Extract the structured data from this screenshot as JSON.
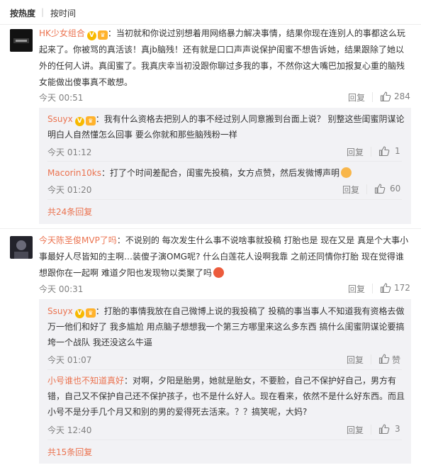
{
  "sort": {
    "by_hot": "按热度",
    "separator": "|",
    "by_time": "按时间"
  },
  "c1": {
    "user": "HK少女组合",
    "text": "：当初就和你说过别想着用网络暴力解决事情，结果你现在连别人的事都这么玩起来了。你被骂的真活该！真jb脑残！还有就是口口声声说保护闺蜜不想告诉她，结果跟除了她以外的任何人讲。真闺蜜了。我真庆幸当初没跟你聊过多我的事，不然你这大嘴巴加报复心重的脑残女能做出傻事真不敢想。",
    "time": "今天 00:51",
    "reply": "回复",
    "likes": "284",
    "r1": {
      "user": "Ssuyx",
      "text": "：我有什么资格去把别人的事不经过别人同意搬到台面上说？ 别整这些闺蜜阴谋论 明白人自然懂怎么回事 要么你就和那些脑残粉一样",
      "time": "今天 01:12",
      "reply": "回复",
      "likes": "1"
    },
    "r2": {
      "user": "Macorin10ks",
      "text": "：打了个时间差配合，闺蜜先投稿，女方点赞，然后发微博声明",
      "time": "今天 01:20",
      "reply": "回复",
      "likes": "60"
    },
    "more": "共24条回复"
  },
  "c2": {
    "user": "今天陈圣俊MVP了吗",
    "text": "：不说别的 每次发生什么事不说啥事就投稿 打胎也是 现在又是 真是个大事小事最好人尽皆知的主啊…装傻子演OMG呢? 什么白莲花人设啊我靠 之前还同情你打胎 现在觉得谁想跟你在一起啊 难道夕阳也发现物以类聚了吗",
    "time": "今天 00:31",
    "reply": "回复",
    "likes": "172",
    "r1": {
      "user": "Ssuyx",
      "text": "：打胎的事情我放在自己微博上说的我投稿了 投稿的事当事人不知道我有资格去做 万一他们和好了 我多尴尬 用点脑子想想我一个第三方哪里来这么多东西 搞什么闺蜜阴谋论要搞垮一个战队 我还没这么牛逼",
      "time": "今天 01:07",
      "reply": "回复",
      "likes": "赞"
    },
    "r2": {
      "user": "小号谁也不知道真好",
      "text": "：对啊，夕阳是胎男，她就是胎女，不要脸，自己不保护好自己，男方有错，自己又不保护自己还不保护孩子，也不是什么好人。现在看来，依然不是什么好东西。而且小号不是分手几个月又和别的男的爱得死去活来。？？搞笑呢，大妈?",
      "time": "今天 12:40",
      "reply": "回复",
      "likes": "3"
    },
    "more": "共15条回复"
  },
  "icons": {
    "like": "thumbs-up-icon",
    "vip": "vip-badge-icon",
    "level": "level-badge-icon",
    "emoji": "emoji-icon"
  },
  "colors": {
    "username": "#eb7350",
    "meta": "#808080",
    "reply_bg": "#f2f2f5"
  }
}
